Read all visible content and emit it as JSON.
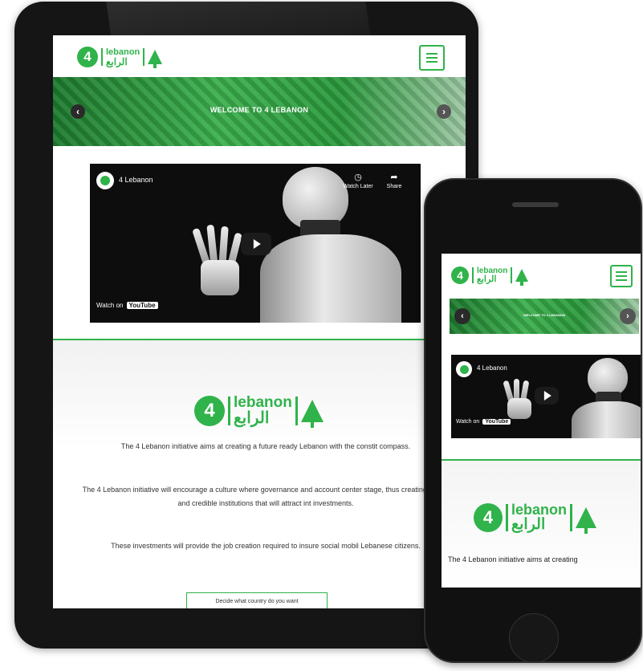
{
  "colors": {
    "brand_green": "#2fb34a",
    "device_frame": "#151515",
    "banner_dark": "#1e7b2f"
  },
  "brand": {
    "numeral": "4",
    "name_en": "lebanon",
    "name_ar": "الرابع",
    "emblem_icon": "cedar-tree-icon"
  },
  "tablet": {
    "banner": {
      "title": "WELCOME TO 4 LEBANON",
      "prev_label": "‹",
      "next_label": "›"
    },
    "video": {
      "channel": "4 Lebanon",
      "watch_later": "Watch Later",
      "share": "Share",
      "watch_on": "Watch on",
      "youtube": "YouTube"
    },
    "about": {
      "p1": "The 4 Lebanon initiative aims at creating a future ready Lebanon with the constit compass.",
      "p2": "The 4 Lebanon initiative will encourage a culture where governance and account center stage, thus creating strong and credible institutions that will attract int investments.",
      "p3": "These investments will provide the job creation required to insure social mobil Lebanese citizens.",
      "cta": "Decide what country do you want"
    }
  },
  "phone": {
    "banner": {
      "title": "WELCOME TO 4 LEBANON",
      "prev_label": "‹",
      "next_label": "›"
    },
    "video": {
      "channel": "4 Lebanon",
      "watch_on": "Watch on",
      "youtube": "YouTube",
      "more": "⋮"
    },
    "about": {
      "p1": "The 4 Lebanon initiative aims at creating"
    }
  }
}
